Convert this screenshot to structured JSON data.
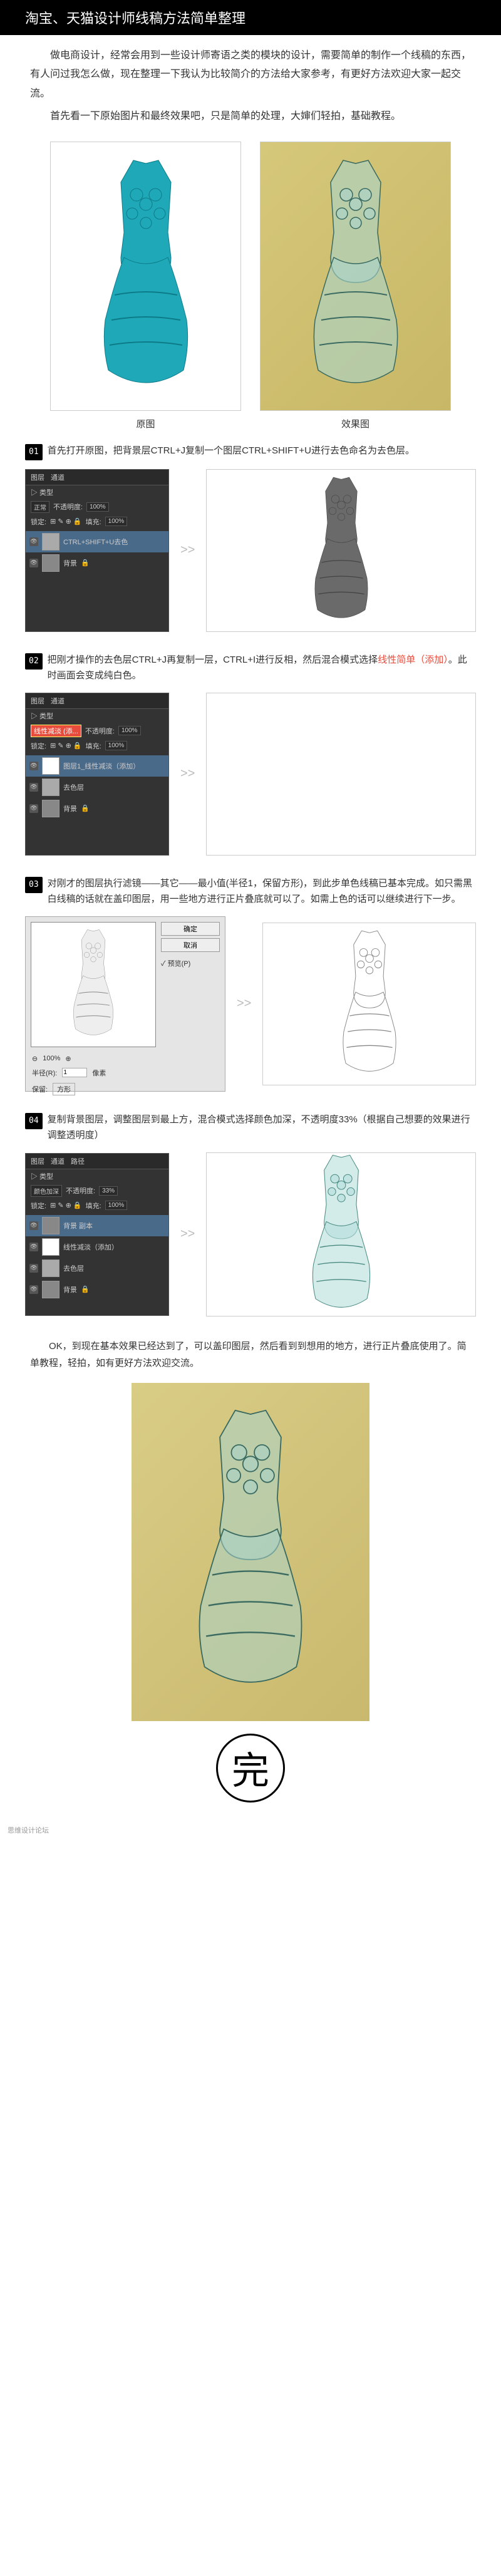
{
  "title": "淘宝、天猫设计师线稿方法简单整理",
  "intro": {
    "p1": "做电商设计，经常会用到一些设计师寄语之类的模块的设计，需要简单的制作一个线稿的东西，有人问过我怎么做，现在整理一下我认为比较简介的方法给大家参考，有更好方法欢迎大家一起交流。",
    "p2": "首先看一下原始图片和最终效果吧，只是简单的处理，大婶们轻拍，基础教程。"
  },
  "compare": {
    "left": "原图",
    "right": "效果图"
  },
  "steps": {
    "s1": {
      "num": "01",
      "text": "首先打开原图，把背景层CTRL+J复制一个图层CTRL+SHIFT+U进行去色命名为去色层。"
    },
    "s2": {
      "num": "02",
      "text_a": "把刚才操作的去色层CTRL+J再复制一层，CTRL+I进行反相，然后混合模式选择",
      "hl": "线性简单（添加）",
      "text_b": "。此时画面会变成纯白色。"
    },
    "s3": {
      "num": "03",
      "text": "对刚才的图层执行滤镜——其它——最小值(半径1，保留方形)，到此步单色线稿已基本完成。如只需黑白线稿的话就在盖印图层，用一些地方进行正片叠底就可以了。如需上色的话可以继续进行下一步。"
    },
    "s4": {
      "num": "04",
      "text": "复制背景图层，调整图层到最上方，混合模式选择颜色加深，不透明度33%（根据自己想要的效果进行调整透明度）"
    }
  },
  "ps": {
    "tab1": "图层",
    "tab2": "通道",
    "tab_path": "路径",
    "type": "▷ 类型",
    "normal": "正常",
    "opacity_lbl": "不透明度:",
    "val100": "100%",
    "lock": "锁定:",
    "fill_lbl": "填充:",
    "linear_dodge": "线性减淡 (添...",
    "color_burn": "颜色加深",
    "val33": "33%",
    "layer_names": {
      "desat_copy": "CTRL+SHIFT+U去色",
      "bg": "背景",
      "desat": "去色层",
      "linear": "图层1_线性减淡（添加）",
      "bg_copy": "背景 副本",
      "merge": "线性减淡（添加）"
    }
  },
  "filter": {
    "ok": "确定",
    "cancel": "取消",
    "preview": "✓ 预览(P)",
    "radius": "半径(R):",
    "radius_val": "1",
    "px": "像素",
    "keep": "保留:",
    "keep_val": "方形"
  },
  "final": "OK，到现在基本效果已经达到了，可以盖印图层，然后看到到想用的地方，进行正片叠底使用了。简单教程，轻拍，如有更好方法欢迎交流。",
  "end": "完",
  "footer": "思维设计论坛"
}
